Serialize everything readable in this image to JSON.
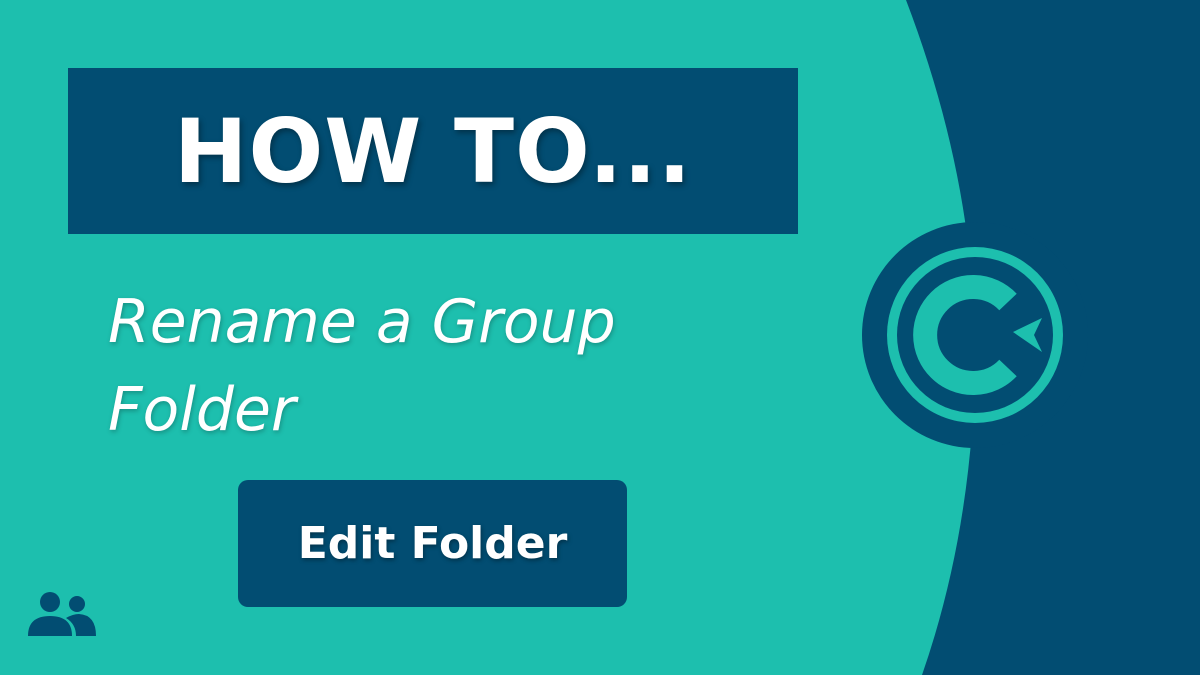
{
  "headline": "HOW TO...",
  "subtitle_lines": [
    "Rename a Group",
    "Folder"
  ],
  "button_label": "Edit Folder",
  "icons": {
    "group": "group-icon",
    "logo": "brand-logo-icon"
  },
  "colors": {
    "background": "#1dbfae",
    "navy": "#024d72",
    "text": "#ffffff"
  }
}
